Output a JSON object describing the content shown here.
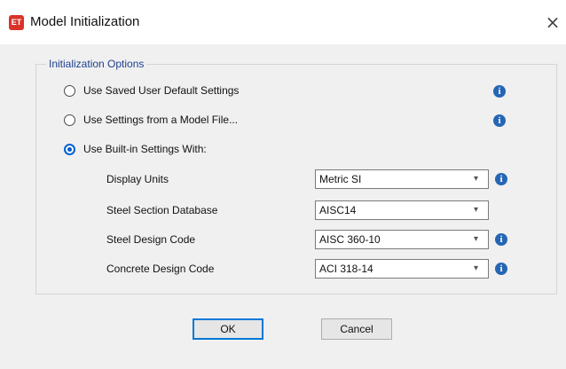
{
  "window": {
    "title": "Model Initialization",
    "app_icon_text": "ET",
    "close_glyph": "×"
  },
  "group": {
    "legend": "Initialization Options"
  },
  "options": [
    {
      "label": "Use Saved User Default Settings",
      "checked": false
    },
    {
      "label": "Use Settings from a Model File...",
      "checked": false
    },
    {
      "label": "Use Built-in Settings With:",
      "checked": true
    }
  ],
  "settings": [
    {
      "label": "Display Units",
      "value": "Metric SI",
      "has_info": true
    },
    {
      "label": "Steel Section Database",
      "value": "AISC14",
      "has_info": false
    },
    {
      "label": "Steel Design Code",
      "value": "AISC 360-10",
      "has_info": true
    },
    {
      "label": "Concrete Design Code",
      "value": "ACI 318-14",
      "has_info": true
    }
  ],
  "buttons": {
    "ok": "OK",
    "cancel": "Cancel"
  },
  "icons": {
    "info": "i",
    "dropdown": "▾"
  },
  "colors": {
    "accent": "#0060d0",
    "info": "#2566b4",
    "legend_text": "#1d3f8f",
    "app_icon": "#d9342b"
  }
}
